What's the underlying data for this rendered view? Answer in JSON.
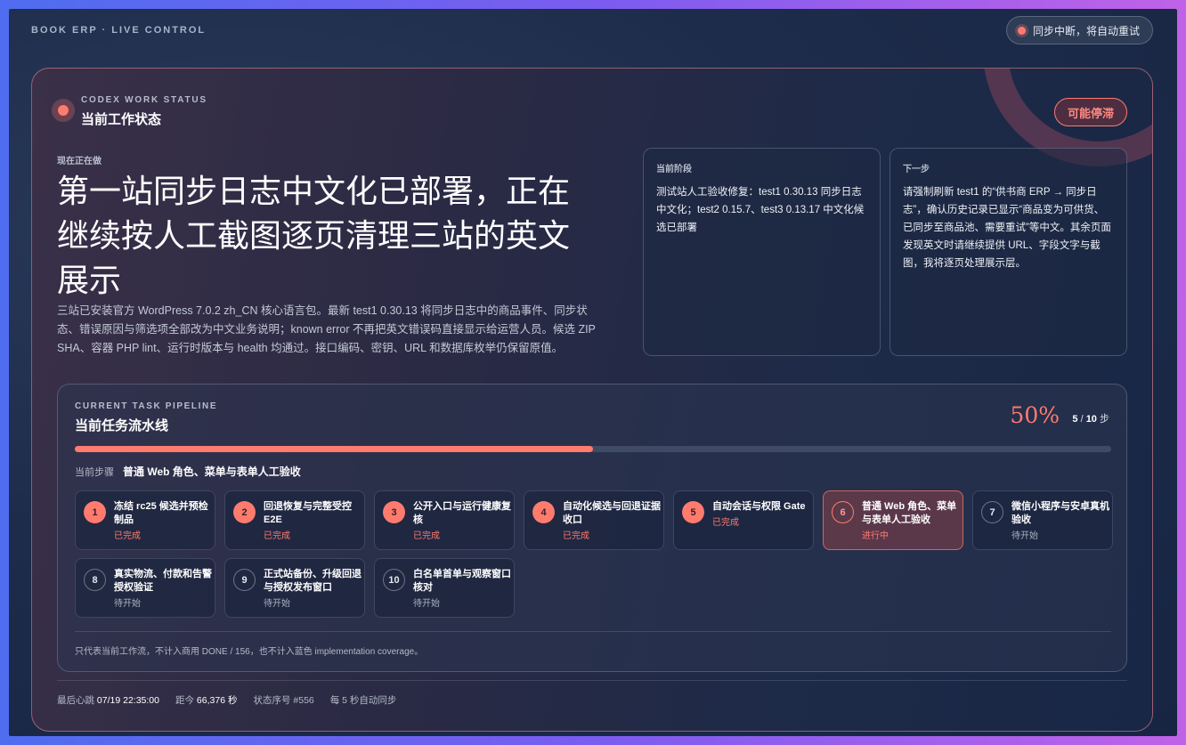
{
  "brand": "BOOK ERP · LIVE CONTROL",
  "sync_status": "同步中断，将自动重试",
  "status": {
    "eyebrow": "CODEX WORK STATUS",
    "title": "当前工作状态",
    "badge": "可能停滞",
    "now_label": "现在正在做",
    "headline": "第一站同步日志中文化已部署，正在继续按人工截图逐页清理三站的英文展示",
    "summary": "三站已安装官方 WordPress 7.0.2 zh_CN 核心语言包。最新 test1 0.30.13 将同步日志中的商品事件、同步状态、错误原因与筛选项全部改为中文业务说明；known error 不再把英文错误码直接显示给运营人员。候选 ZIP SHA、容器 PHP lint、运行时版本与 health 均通过。接口编码、密钥、URL 和数据库枚举仍保留原值。"
  },
  "current_phase": {
    "label": "当前阶段",
    "text": "测试站人工验收修复：test1 0.30.13 同步日志中文化；test2 0.15.7、test3 0.13.17 中文化候选已部署"
  },
  "next_step": {
    "label": "下一步",
    "text": "请强制刷新 test1 的“供书商 ERP → 同步日志”，确认历史记录已显示“商品变为可供货、已同步至商品池、需要重试”等中文。其余页面发现英文时请继续提供 URL、字段文字与截图，我将逐页处理展示层。"
  },
  "pipeline": {
    "eyebrow": "CURRENT TASK PIPELINE",
    "title": "当前任务流水线",
    "percent_label": "50%",
    "progress": 0.5,
    "done_count": "5",
    "total_count": "10",
    "steps_unit": "步",
    "count_sep": "/",
    "current_step_label": "当前步骤",
    "current_step_value": "普通 Web 角色、菜单与表单人工验收",
    "steps": [
      {
        "num": "1",
        "name": "冻结 rc25 候选并预检制品",
        "status": "已完成",
        "state": "done"
      },
      {
        "num": "2",
        "name": "回退恢复与完整受控 E2E",
        "status": "已完成",
        "state": "done"
      },
      {
        "num": "3",
        "name": "公开入口与运行健康复核",
        "status": "已完成",
        "state": "done"
      },
      {
        "num": "4",
        "name": "自动化候选与回退证据收口",
        "status": "已完成",
        "state": "done"
      },
      {
        "num": "5",
        "name": "自动会话与权限 Gate",
        "status": "已完成",
        "state": "done"
      },
      {
        "num": "6",
        "name": "普通 Web 角色、菜单与表单人工验收",
        "status": "进行中",
        "state": "active"
      },
      {
        "num": "7",
        "name": "微信小程序与安卓真机验收",
        "status": "待开始",
        "state": "todo"
      },
      {
        "num": "8",
        "name": "真实物流、付款和告警授权验证",
        "status": "待开始",
        "state": "todo"
      },
      {
        "num": "9",
        "name": "正式站备份、升级回退与授权发布窗口",
        "status": "待开始",
        "state": "todo"
      },
      {
        "num": "10",
        "name": "白名单首单与观察窗口核对",
        "status": "待开始",
        "state": "todo"
      }
    ],
    "note": "只代表当前工作流，不计入商用 DONE / 156，也不计入蓝色 implementation coverage。"
  },
  "footer": {
    "heartbeat_label": "最后心跳",
    "heartbeat_value": "07/19 22:35:00",
    "elapsed_label": "距今",
    "elapsed_value": "66,376 秒",
    "seq_label": "状态序号",
    "seq_value": "#556",
    "auto_sync": "每 5 秒自动同步"
  },
  "colors": {
    "accent": "#ff7b6e",
    "background": "#1d2c4a",
    "card_border": "#f08c96"
  }
}
